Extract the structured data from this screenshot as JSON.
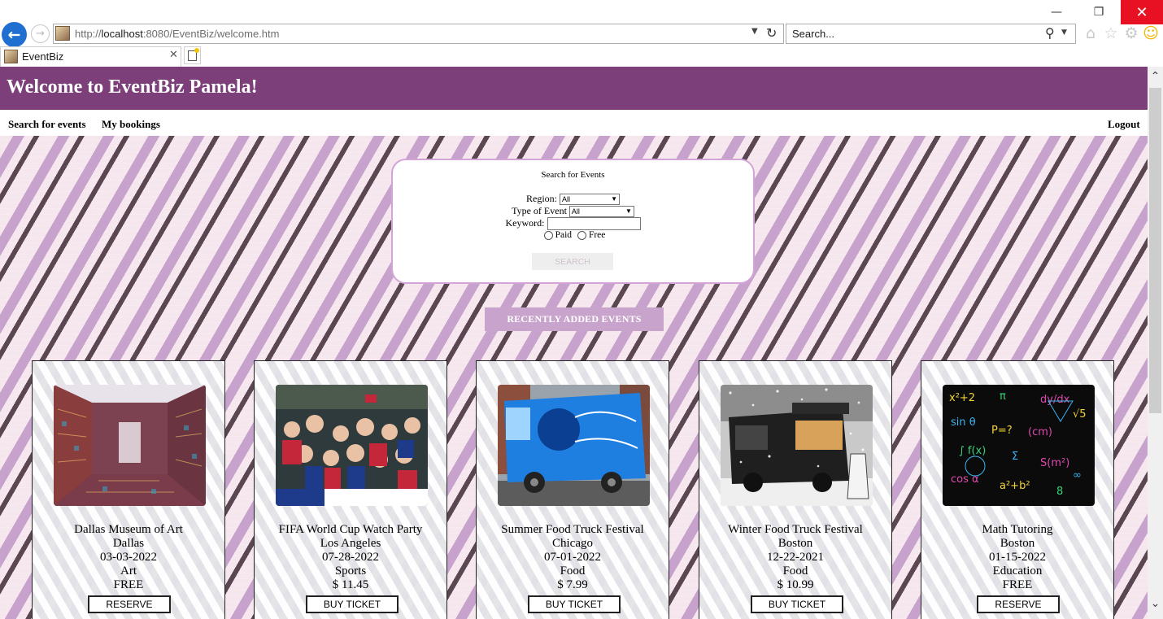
{
  "browser": {
    "window_controls": {
      "minimize": "—",
      "restore": "❐",
      "close": "✕"
    },
    "address_url_prefix": "http://",
    "address_url_host": "localhost",
    "address_url_rest": ":8080/EventBiz/welcome.htm",
    "search_placeholder": "Search...",
    "tab_title": "EventBiz",
    "icons": [
      "back-arrow-icon",
      "forward-arrow-icon",
      "refresh-icon",
      "search-icon",
      "home-icon",
      "star-icon",
      "gear-icon",
      "smiley-icon"
    ]
  },
  "header": {
    "title": "Welcome to EventBiz Pamela!",
    "bg_color": "#7d3f7a"
  },
  "nav": {
    "search_events": "Search for events",
    "my_bookings": "My bookings",
    "logout": "Logout"
  },
  "search_panel": {
    "title": "Search for Events",
    "region_label": "Region:",
    "region_value": "All",
    "type_label": "Type of Event",
    "type_value": "All",
    "keyword_label": "Keyword:",
    "keyword_value": "",
    "paid_label": "Paid",
    "free_label": "Free",
    "search_button": "SEARCH"
  },
  "recent": {
    "title": "RECENTLY ADDED EVENTS"
  },
  "events": [
    {
      "name": "Dallas Museum of Art",
      "city": "Dallas",
      "date": "03-03-2022",
      "category": "Art",
      "price": "FREE",
      "button": "RESERVE"
    },
    {
      "name": "FIFA World Cup Watch Party",
      "city": "Los Angeles",
      "date": "07-28-2022",
      "category": "Sports",
      "price": "$ 11.45",
      "button": "BUY TICKET"
    },
    {
      "name": "Summer Food Truck Festival",
      "city": "Chicago",
      "date": "07-01-2022",
      "category": "Food",
      "price": "$ 7.99",
      "button": "BUY TICKET"
    },
    {
      "name": "Winter Food Truck Festival",
      "city": "Boston",
      "date": "12-22-2021",
      "category": "Food",
      "price": "$ 10.99",
      "button": "BUY TICKET"
    },
    {
      "name": "Math Tutoring",
      "city": "Boston",
      "date": "01-15-2022",
      "category": "Education",
      "price": "FREE",
      "button": "RESERVE"
    }
  ],
  "colors": {
    "accent_purple": "#7d3f7a",
    "banner_lilac": "#c8a3cc",
    "panel_border": "#d3a4d6",
    "close_red": "#e81123"
  }
}
